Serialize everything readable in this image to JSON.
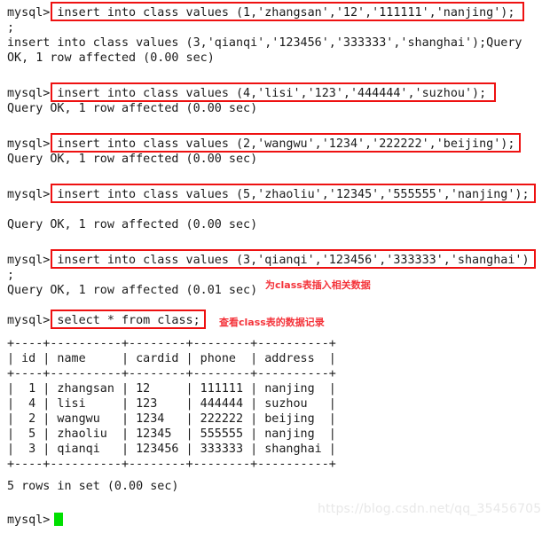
{
  "terminal": {
    "prompt": "mysql>",
    "background_color": "#ffffff",
    "text_color": "#1b1b1b",
    "highlight_color": "#ee1111",
    "annotation_color": "#f4333a",
    "cursor_color": "#00e000",
    "watermark": "https://blog.csdn.net/qq_35456705",
    "clipped_top_line": "' '",
    "lines": {
      "l01": "mysql> insert into class values (1,'zhangsan','12','111111','nanjing');",
      "l02": ";",
      "l03": "insert into class values (3,'qianqi','123456','333333','shanghai');Query",
      "l04": "OK, 1 row affected (0.00 sec)",
      "l05": "mysql> insert into class values (4,'lisi','123','444444','suzhou');",
      "l06": "Query OK, 1 row affected (0.00 sec)",
      "l07": "mysql> insert into class values (2,'wangwu','1234','222222','beijing');",
      "l08": "Query OK, 1 row affected (0.00 sec)",
      "l09": "mysql> insert into class values (5,'zhaoliu','12345','555555','nanjing');",
      "l10": "Query OK, 1 row affected (0.00 sec)",
      "l11": "mysql> insert into class values (3,'qianqi','123456','333333','shanghai')",
      "l12": ";",
      "l13": "Query OK, 1 row affected (0.01 sec)",
      "l14": "mysql> select * from class;",
      "l15": "+----+----------+--------+--------+----------+",
      "l16": "| id | name     | cardid | phone  | address  |",
      "l17": "+----+----------+--------+--------+----------+",
      "l18": "|  1 | zhangsan | 12     | 111111 | nanjing  |",
      "l19": "|  4 | lisi     | 123    | 444444 | suzhou   |",
      "l20": "|  2 | wangwu   | 1234   | 222222 | beijing  |",
      "l21": "|  5 | zhaoliu  | 12345  | 555555 | nanjing  |",
      "l22": "|  3 | qianqi   | 123456 | 333333 | shanghai |",
      "l23": "+----+----------+--------+--------+----------+",
      "l24": "5 rows in set (0.00 sec)",
      "l25": "mysql>"
    },
    "annotations": {
      "insert_note": "为class表插入相关数据",
      "select_note": "查看class表的数据记录"
    },
    "commands": [
      "insert into class values (1,'zhangsan','12','111111','nanjing');",
      "insert into class values (4,'lisi','123','444444','suzhou');",
      "insert into class values (2,'wangwu','1234','222222','beijing');",
      "insert into class values (5,'zhaoliu','12345','555555','nanjing');",
      "insert into class values (3,'qianqi','123456','333333','shanghai')",
      "select * from class;"
    ],
    "results": {
      "table_name": "class",
      "columns": [
        "id",
        "name",
        "cardid",
        "phone",
        "address"
      ],
      "rows": [
        [
          "1",
          "zhangsan",
          "12",
          "111111",
          "nanjing"
        ],
        [
          "4",
          "lisi",
          "123",
          "444444",
          "suzhou"
        ],
        [
          "2",
          "wangwu",
          "1234",
          "222222",
          "beijing"
        ],
        [
          "5",
          "zhaoliu",
          "12345",
          "555555",
          "nanjing"
        ],
        [
          "3",
          "qianqi",
          "123456",
          "333333",
          "shanghai"
        ]
      ],
      "row_count_text": "5 rows in set (0.00 sec)",
      "affected_texts": [
        "Query OK, 1 row affected (0.00 sec)",
        "Query OK, 1 row affected (0.01 sec)"
      ]
    }
  }
}
